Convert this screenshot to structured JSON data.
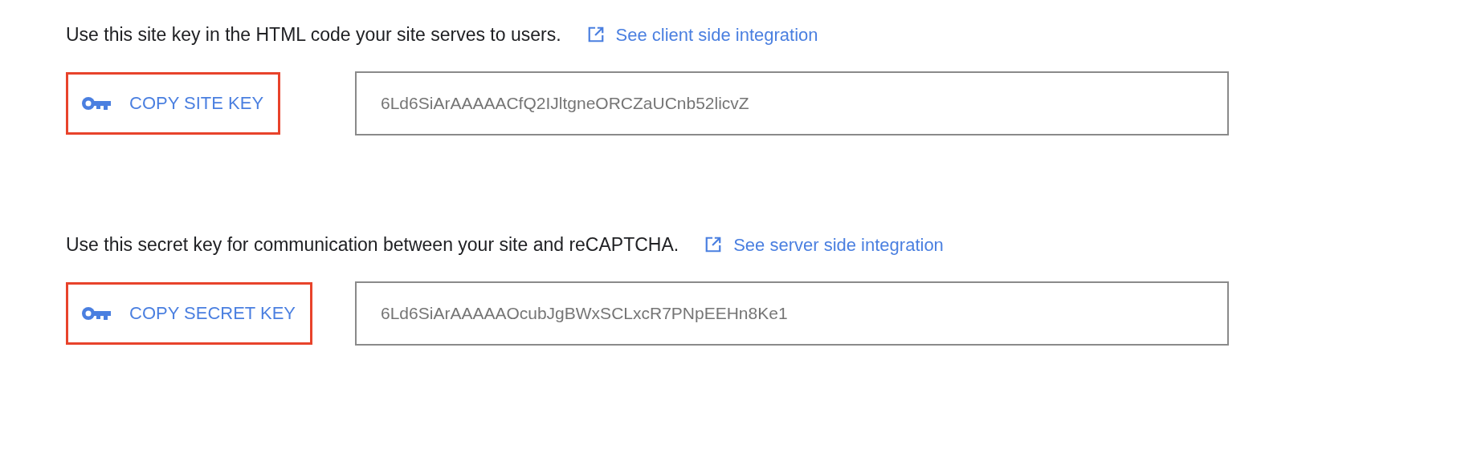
{
  "sections": [
    {
      "description": "Use this site key in the HTML code your site serves to users.",
      "link": "See client side integration",
      "button": "COPY SITE KEY",
      "highlighted": true,
      "key": "6Ld6SiArAAAAACfQ2IJltgneORCZaUCnb52licvZ"
    },
    {
      "description": "Use this secret key for communication between your site and reCAPTCHA.",
      "link": "See server side integration",
      "button": "COPY SECRET KEY",
      "highlighted": true,
      "key": "6Ld6SiArAAAAAOcubJgBWxSCLxcR7PNpEEHn8Ke1"
    }
  ]
}
